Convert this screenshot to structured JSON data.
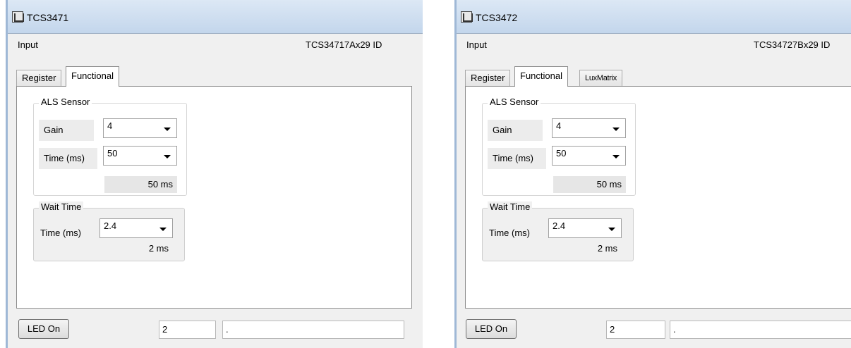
{
  "windows": [
    {
      "title": "TCS3471",
      "input_label": "Input",
      "device_id": "TCS34717Ax29 ID",
      "tabs": [
        {
          "label": "Register",
          "active": false
        },
        {
          "label": "Functional",
          "active": true
        }
      ],
      "als_sensor": {
        "legend": "ALS Sensor",
        "gain_label": "Gain",
        "gain_value": "4",
        "time_label": "Time (ms)",
        "time_value": "50",
        "time_readout": "50 ms"
      },
      "wait_time": {
        "legend": "Wait Time",
        "time_label": "Time (ms)",
        "time_value": "2.4",
        "readout": "2 ms"
      },
      "footer": {
        "led_button": "LED On",
        "value_field": "2",
        "status_field": "."
      }
    },
    {
      "title": "TCS3472",
      "input_label": "Input",
      "device_id": "TCS34727Bx29 ID",
      "tabs": [
        {
          "label": "Register",
          "active": false
        },
        {
          "label": "Functional",
          "active": true
        },
        {
          "label": "LuxMatrix",
          "active": false
        }
      ],
      "als_sensor": {
        "legend": "ALS Sensor",
        "gain_label": "Gain",
        "gain_value": "4",
        "time_label": "Time (ms)",
        "time_value": "50",
        "time_readout": "50 ms"
      },
      "wait_time": {
        "legend": "Wait Time",
        "time_label": "Time (ms)",
        "time_value": "2.4",
        "readout": "2 ms"
      },
      "footer": {
        "led_button": "LED On",
        "value_field": "2",
        "status_field": "."
      }
    }
  ],
  "icons": {
    "app_icon": "app-window-icon",
    "dropdown_arrow": "chevron-down-icon"
  },
  "colors": {
    "titlebar": "#c3d6ec",
    "panel_bg": "#f0f0f0",
    "content_bg": "#ffffff"
  }
}
